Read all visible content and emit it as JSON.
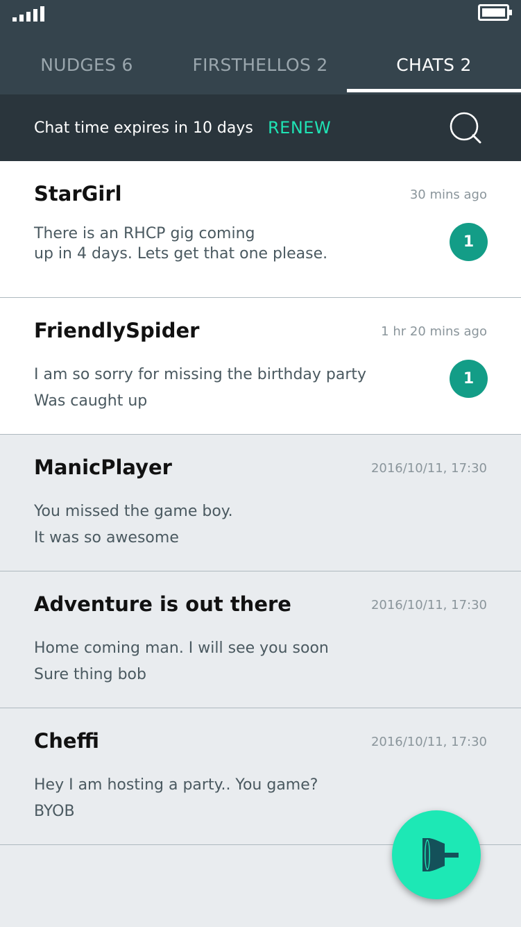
{
  "tabs": [
    {
      "label": "NUDGES 6"
    },
    {
      "label": "FIRSTHELLOS 2"
    },
    {
      "label": "CHATS 2"
    }
  ],
  "banner": {
    "text": "Chat time expires in 10 days",
    "renew_label": "RENEW"
  },
  "chats": [
    {
      "name": "StarGirl",
      "time": "30 mins ago",
      "line1": "There is an RHCP gig coming",
      "line2": "up in 4 days. Lets get that one please.",
      "badge": "1"
    },
    {
      "name": "FriendlySpider",
      "time": "1 hr 20 mins ago",
      "line1": "I am so sorry for missing the birthday party",
      "line2": "Was caught up",
      "badge": "1"
    },
    {
      "name": "ManicPlayer",
      "time": "2016/10/11, 17:30",
      "line1": "You missed the game boy.",
      "line2": "It was so awesome"
    },
    {
      "name": "Adventure is out there",
      "time": "2016/10/11, 17:30",
      "line1": "Home coming man. I will see you soon",
      "line2": "Sure thing bob"
    },
    {
      "name": "Cheffi",
      "time": "2016/10/11, 17:30",
      "line1": "Hey I am hosting a party.. You game?",
      "line2": "BYOB"
    }
  ],
  "icons": {
    "signal": "signal-icon",
    "battery": "battery-icon",
    "search": "search-icon",
    "fab": "megaphone-icon"
  },
  "colors": {
    "header": "#35444d",
    "banner": "#2a353c",
    "accent": "#1fe3b4",
    "badge": "#139d87",
    "fab": "#1de8b5"
  }
}
